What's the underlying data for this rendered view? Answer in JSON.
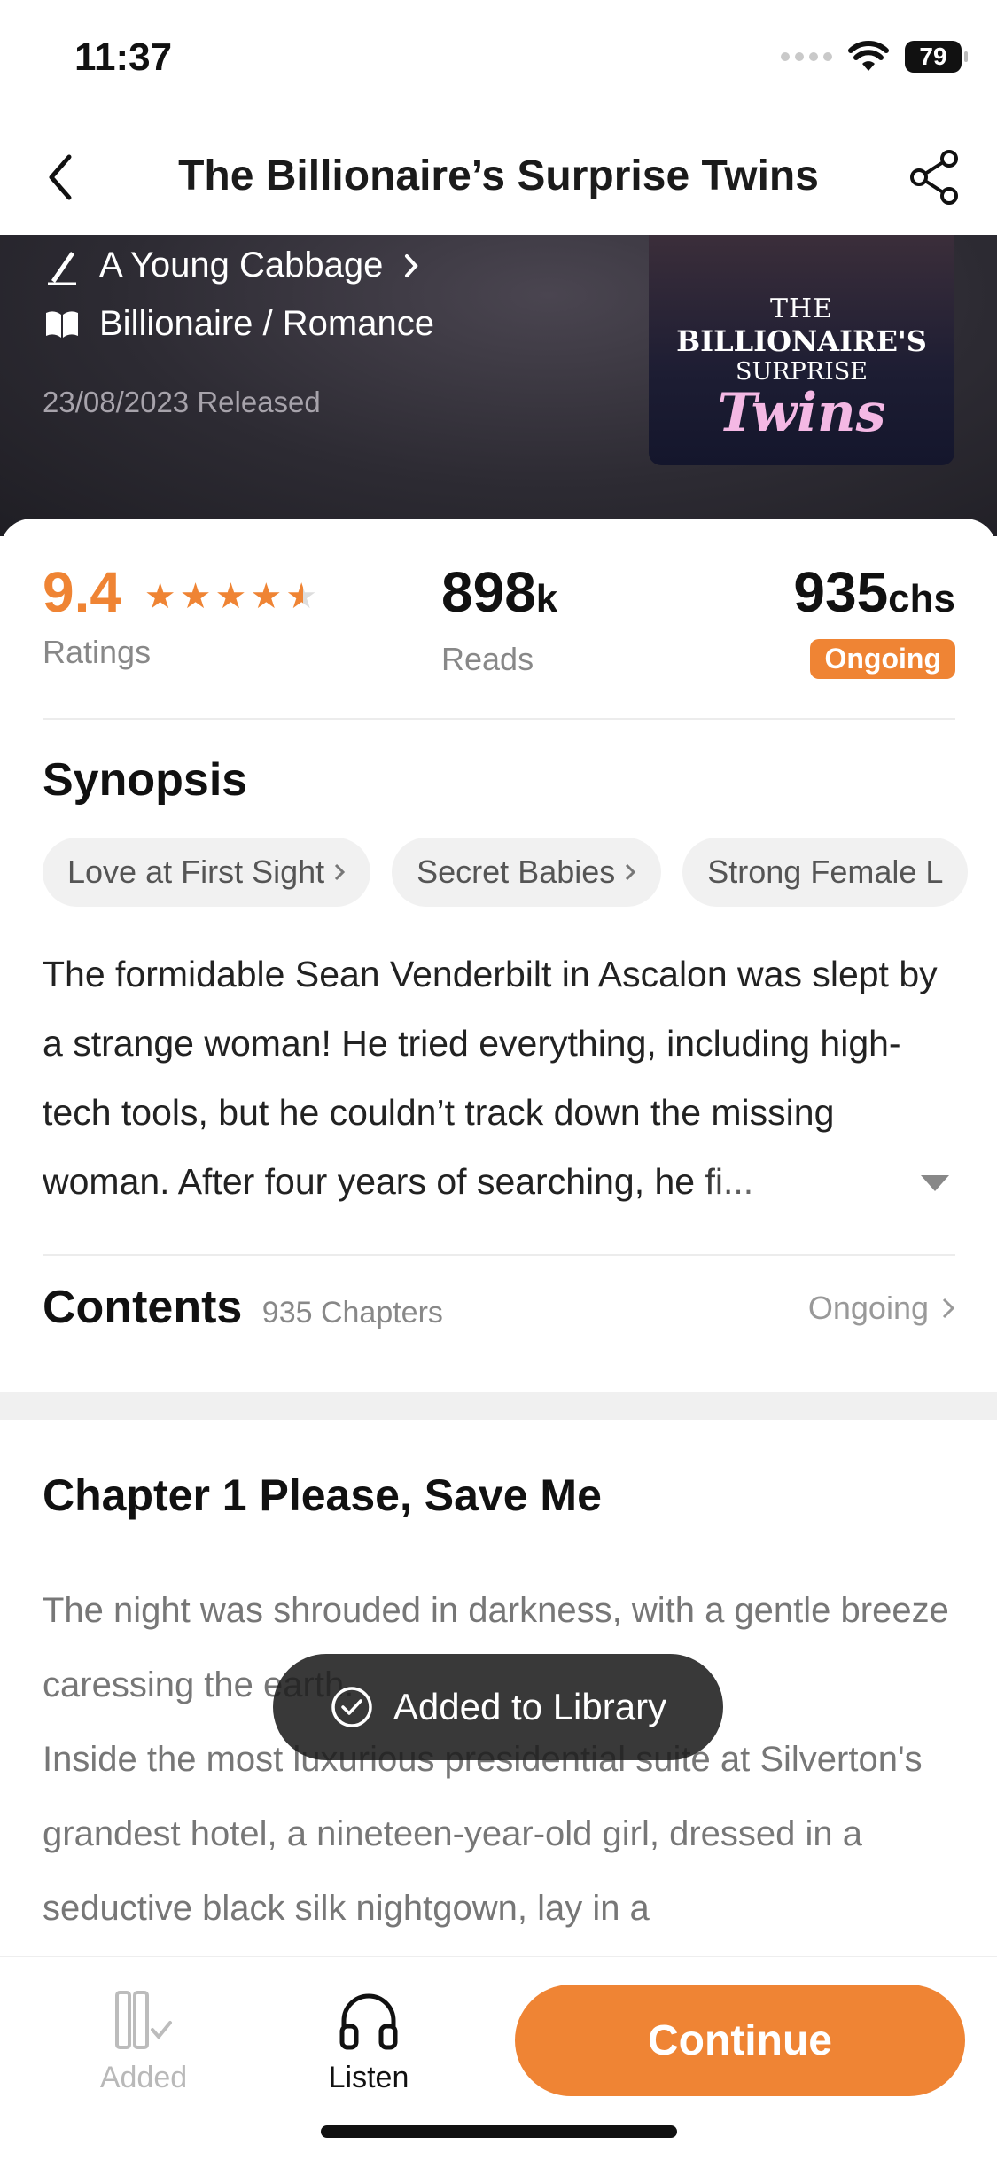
{
  "status_bar": {
    "time": "11:37",
    "battery": "79"
  },
  "nav": {
    "title": "The Billionaire’s Surprise Twins"
  },
  "book": {
    "author": "A Young Cabbage",
    "genre": "Billionaire / Romance",
    "release": "23/08/2023 Released",
    "cover_lines": [
      "THE",
      "BILLIONAIRE'S",
      "SURPRISE",
      "Twins"
    ]
  },
  "stats": {
    "rating_value": "9.4",
    "rating_stars": 4.5,
    "rating_label": "Ratings",
    "reads_value": "898",
    "reads_unit": "k",
    "reads_label": "Reads",
    "chapters_value": "935",
    "chapters_unit": "chs",
    "status_badge": "Ongoing"
  },
  "synopsis": {
    "title": "Synopsis",
    "tags": [
      "Love at First Sight",
      "Secret Babies",
      "Strong Female L"
    ],
    "text": "The formidable Sean Venderbilt in Ascalon was slept by a strange woman! He tried everything, including high-tech tools, but he couldn’t track down the missing woman. After four years of searching, he fi..."
  },
  "contents": {
    "title": "Contents",
    "count": "935 Chapters",
    "status": "Ongoing"
  },
  "chapter": {
    "title": "Chapter 1 Please, Save Me",
    "paragraphs": [
      "The night was shrouded in darkness, with a gentle breeze caressing the earth.",
      "Inside the most luxurious presidential suite at Silverton's grandest hotel, a nineteen-year-old girl, dressed in a seductive black silk nightgown, lay in a"
    ]
  },
  "toast": {
    "text": "Added to Library"
  },
  "bottom_bar": {
    "added_label": "Added",
    "listen_label": "Listen",
    "continue_label": "Continue"
  },
  "colors": {
    "accent": "#ef8434",
    "toast_bg": "#1e1e1e",
    "hero_bg": "#2d2b33"
  },
  "icons": [
    "back-chevron-icon",
    "share-icon",
    "pen-icon",
    "chevron-right-icon",
    "book-icon",
    "star-icon",
    "chevron-down-icon",
    "check-circle-icon",
    "library-added-icon",
    "headphones-icon"
  ]
}
